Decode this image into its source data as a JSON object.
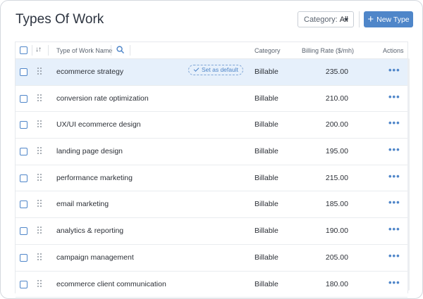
{
  "page": {
    "title": "Types Of Work"
  },
  "toolbar": {
    "category_label": "Category:",
    "category_value": "All",
    "new_button_label": "New Type"
  },
  "table": {
    "headers": {
      "name": "Type of Work Name",
      "category": "Category",
      "rate": "Billing Rate ($/mh)",
      "actions": "Actions"
    },
    "default_badge": "Set as default",
    "actions_glyph": "•••",
    "rows": [
      {
        "name": "ecommerce strategy",
        "category": "Billable",
        "rate": "235.00"
      },
      {
        "name": "conversion rate optimization",
        "category": "Billable",
        "rate": "210.00"
      },
      {
        "name": "UX/UI ecommerce design",
        "category": "Billable",
        "rate": "200.00"
      },
      {
        "name": "landing page design",
        "category": "Billable",
        "rate": "195.00"
      },
      {
        "name": "performance marketing",
        "category": "Billable",
        "rate": "215.00"
      },
      {
        "name": "email marketing",
        "category": "Billable",
        "rate": "185.00"
      },
      {
        "name": "analytics & reporting",
        "category": "Billable",
        "rate": "190.00"
      },
      {
        "name": "campaign management",
        "category": "Billable",
        "rate": "205.00"
      },
      {
        "name": "ecommerce client communication",
        "category": "Billable",
        "rate": "180.00"
      }
    ]
  },
  "colors": {
    "accent": "#4f86c9",
    "selected_row": "#e6f0fb"
  }
}
